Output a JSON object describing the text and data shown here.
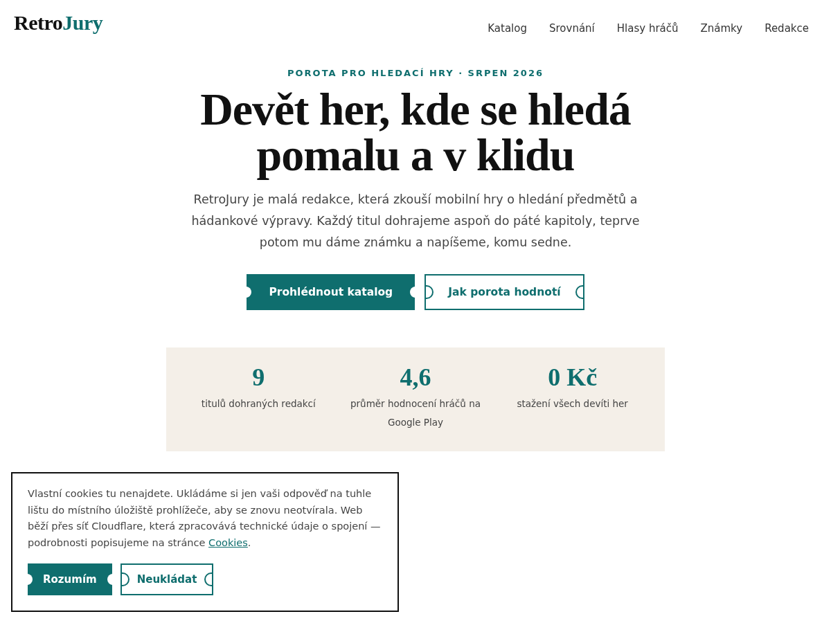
{
  "brand": {
    "first": "Retro",
    "second": "Jury"
  },
  "nav": [
    "Katalog",
    "Srovnání",
    "Hlasy hráčů",
    "Známky",
    "Redakce"
  ],
  "hero": {
    "eyebrow": "POROTA PRO HLEDACÍ HRY · SRPEN 2026",
    "title": "Devět her, kde se hledá pomalu a v klidu",
    "lead": "RetroJury je malá redakce, která zkouší mobilní hry o hledání předmětů a hádankové výpravy. Každý titul dohrajeme aspoň do páté kapitoly, teprve potom mu dáme známku a napíšeme, komu sedne.",
    "buttons": [
      {
        "label": "Prohlédnout katalog",
        "kind": "primary"
      },
      {
        "label": "Jak porota hodnotí",
        "kind": "outline"
      }
    ]
  },
  "stats": [
    {
      "value": "9",
      "label": "titulů dohraných redakcí"
    },
    {
      "value": "4,6",
      "label": "průměr hodnocení hráčů na Google Play"
    },
    {
      "value": "0 Kč",
      "label": "stažení všech devíti her"
    }
  ],
  "cookie_banner": {
    "text": "Vlastní cookies tu nenajdete. Ukládáme si jen vaši odpověď na tuhle lištu do místního úložiště prohlížeče, aby se znovu neotvírala. Web běží přes síť Cloudflare, která zpracovává technické údaje o spojení — podrobnosti popisujeme na stránce",
    "link": "Cookies",
    "after": ".",
    "buttons": [
      {
        "label": "Rozumím",
        "kind": "primary"
      },
      {
        "label": "Neukládat",
        "kind": "outline"
      }
    ]
  }
}
